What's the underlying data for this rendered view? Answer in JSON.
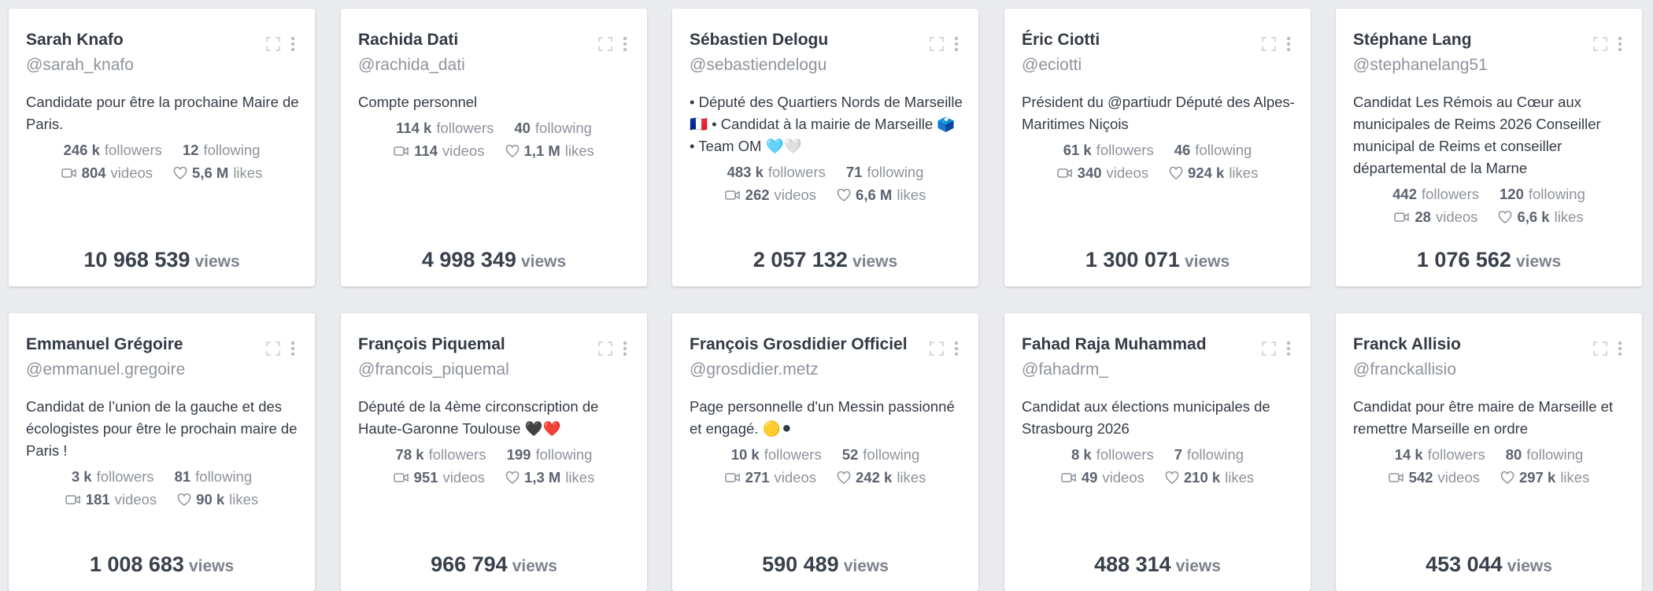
{
  "cards": [
    {
      "name": "Sarah Knafo",
      "handle": "@sarah_knafo",
      "bio": "Candidate pour être la prochaine Maire de Paris.",
      "followers": "246 k",
      "following": "12",
      "videos": "804",
      "likes": "5,6 M",
      "views": "10 968 539"
    },
    {
      "name": "Rachida Dati",
      "handle": "@rachida_dati",
      "bio": "Compte personnel",
      "followers": "114 k",
      "following": "40",
      "videos": "114",
      "likes": "1,1 M",
      "views": "4 998 349"
    },
    {
      "name": "Sébastien Delogu",
      "handle": "@sebastiendelogu",
      "bio": "• Député des Quartiers Nords de Marseille 🇫🇷 • Candidat à la mairie de Marseille 🗳️ • Team OM 🩵🤍",
      "followers": "483 k",
      "following": "71",
      "videos": "262",
      "likes": "6,6 M",
      "views": "2 057 132"
    },
    {
      "name": "Éric Ciotti",
      "handle": "@eciotti",
      "bio": "Président du @partiudr Député des Alpes-Maritimes Niçois",
      "followers": "61 k",
      "following": "46",
      "videos": "340",
      "likes": "924 k",
      "views": "1 300 071"
    },
    {
      "name": "Stéphane Lang",
      "handle": "@stephanelang51",
      "bio": "Candidat Les Rémois au Cœur aux municipales de Reims 2026 Conseiller municipal de Reims et conseiller départemental de la Marne",
      "followers": "442",
      "following": "120",
      "videos": "28",
      "likes": "6,6 k",
      "views": "1 076 562"
    },
    {
      "name": "Emmanuel Grégoire",
      "handle": "@emmanuel.gregoire",
      "bio": "Candidat de l’union de la gauche et des écologistes pour être le prochain maire de Paris !",
      "followers": "3 k",
      "following": "81",
      "videos": "181",
      "likes": "90 k",
      "views": "1 008 683"
    },
    {
      "name": "François Piquemal",
      "handle": "@francois_piquemal",
      "bio": "Député de la 4ème circonscription de Haute-Garonne Toulouse 🖤❤️",
      "followers": "78 k",
      "following": "199",
      "videos": "951",
      "likes": "1,3 M",
      "views": "966 794"
    },
    {
      "name": "François Grosdidier Officiel",
      "handle": "@grosdidier.metz",
      "bio": "Page personnelle d'un Messin passionné et engagé. 🟡⚫",
      "followers": "10 k",
      "following": "52",
      "videos": "271",
      "likes": "242 k",
      "views": "590 489"
    },
    {
      "name": "Fahad Raja Muhammad",
      "handle": "@fahadrm_",
      "bio": "Candidat aux élections municipales de Strasbourg 2026",
      "followers": "8 k",
      "following": "7",
      "videos": "49",
      "likes": "210 k",
      "views": "488 314"
    },
    {
      "name": "Franck Allisio",
      "handle": "@franckallisio",
      "bio": "Candidat pour être maire de Marseille et remettre Marseille en ordre",
      "followers": "14 k",
      "following": "80",
      "videos": "542",
      "likes": "297 k",
      "views": "453 044"
    }
  ],
  "labels": {
    "followers": "followers",
    "following": "following",
    "videos": "videos",
    "likes": "likes",
    "views": "views"
  },
  "icons": {
    "expand": "expand-icon",
    "menu": "more-vertical-icon",
    "video": "video-camera-icon",
    "like": "heart-icon"
  }
}
